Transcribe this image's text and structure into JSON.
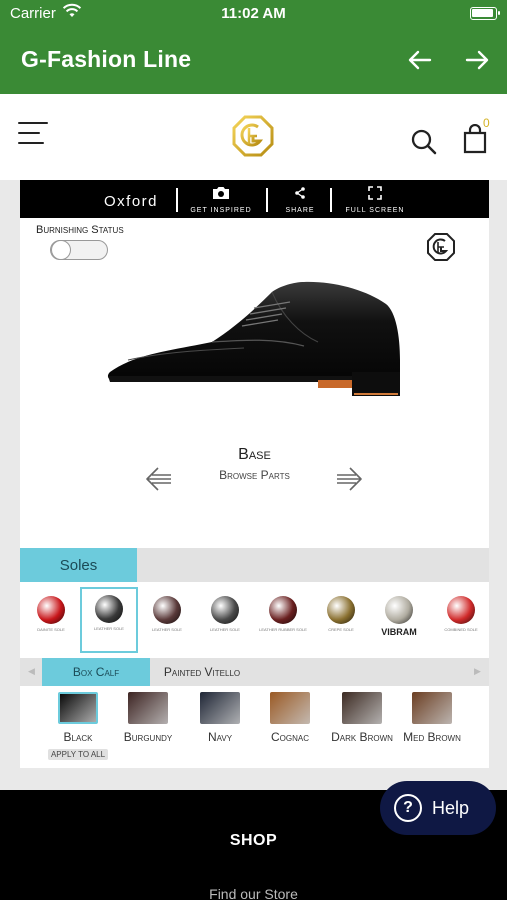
{
  "status": {
    "carrier": "Carrier",
    "time": "11:02 AM"
  },
  "appbar": {
    "title": "G-Fashion Line"
  },
  "header": {
    "cart_count": "0"
  },
  "toolbar": {
    "model": "Oxford",
    "get_inspired": "GET INSPIRED",
    "share": "SHARE",
    "full_screen": "FULL SCREEN"
  },
  "configurator": {
    "burnishing_label": "Burnishing Status",
    "part_title": "Base",
    "part_subtitle": "Browse Parts"
  },
  "soles": {
    "tab_label": "Soles",
    "items": [
      {
        "name": "DAINITE SOLE",
        "color": "#c8161a"
      },
      {
        "name": "LEATHER SOLE",
        "color": "#3a3a3a"
      },
      {
        "name": "LEATHER SOLE",
        "color": "#5a3a3a"
      },
      {
        "name": "LEATHER SOLE",
        "color": "#4a4a4a"
      },
      {
        "name": "LEATHER RUBBER SOLE",
        "color": "#6a2020"
      },
      {
        "name": "CREPE SOLE",
        "color": "#8a7030"
      },
      {
        "name": "VIBRAM",
        "color": "#b0aca0"
      },
      {
        "name": "COMBINED SOLE",
        "color": "#d02a2a"
      }
    ]
  },
  "leather": {
    "tabs": [
      "Box Calf",
      "Painted Vitello"
    ],
    "colors": [
      {
        "name": "Black",
        "color": "#0a0a0a"
      },
      {
        "name": "Burgundy",
        "color": "#3d2422"
      },
      {
        "name": "Navy",
        "color": "#1f2636"
      },
      {
        "name": "Cognac",
        "color": "#9a5a25"
      },
      {
        "name": "Dark Brown",
        "color": "#3c2a22"
      },
      {
        "name": "Med Brown",
        "color": "#6b3e22"
      }
    ],
    "apply_all": "APPLY TO ALL"
  },
  "footer": {
    "shop": "SHOP",
    "find_store": "Find our Store"
  },
  "help": {
    "label": "Help"
  },
  "colors": {
    "appbar": "#3a8a35",
    "accent_tab": "#6ccbdc",
    "help_bg": "#0f1844",
    "cart_badge": "#d4b224"
  }
}
